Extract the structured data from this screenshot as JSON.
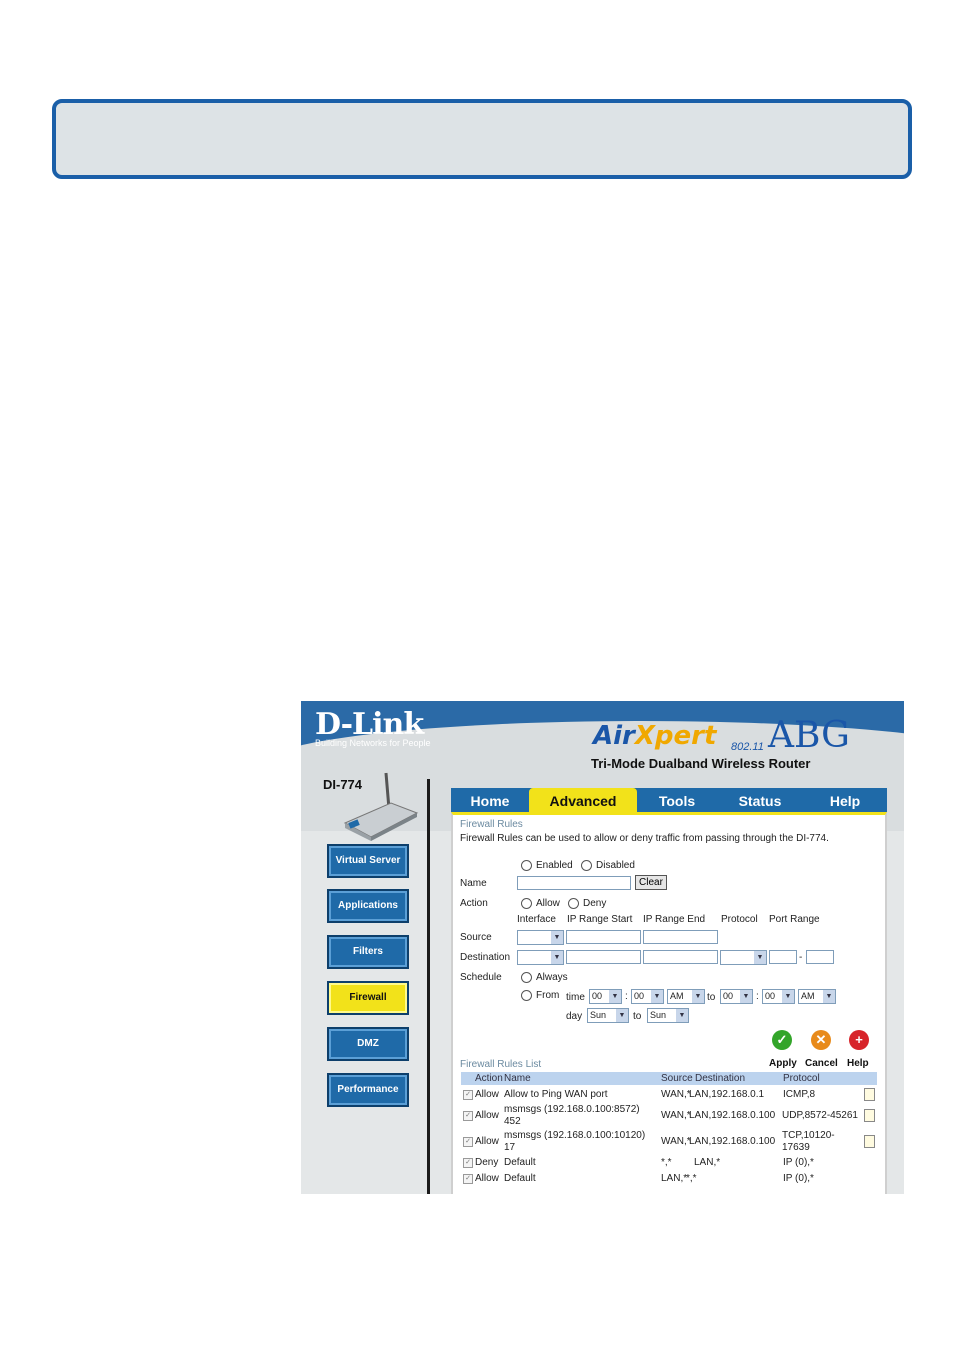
{
  "header": {
    "brand": "D-Link",
    "tagline": "Building Networks for People",
    "product_air": "Air",
    "product_x": "Xpert",
    "product_abg": "ABG",
    "product_80211": "802.11",
    "product_sub": "Tri-Mode Dualband Wireless Router",
    "model": "DI-774"
  },
  "sidebar": {
    "items": [
      {
        "label": "Virtual Server"
      },
      {
        "label": "Applications"
      },
      {
        "label": "Filters"
      },
      {
        "label": "Firewall"
      },
      {
        "label": "DMZ"
      },
      {
        "label": "Performance"
      }
    ]
  },
  "tabs": [
    "Home",
    "Advanced",
    "Tools",
    "Status",
    "Help"
  ],
  "firewall": {
    "title": "Firewall Rules",
    "description": "Firewall Rules can be used to allow or deny traffic from passing through the DI-774.",
    "enabled_label": "Enabled",
    "disabled_label": "Disabled",
    "name_label": "Name",
    "clear_label": "Clear",
    "action_label": "Action",
    "allow_label": "Allow",
    "deny_label": "Deny",
    "col_interface": "Interface",
    "col_ip_start": "IP Range Start",
    "col_ip_end": "IP Range End",
    "col_protocol": "Protocol",
    "col_port_range": "Port Range",
    "source_label": "Source",
    "destination_label": "Destination",
    "schedule_label": "Schedule",
    "always_label": "Always",
    "from_label": "From",
    "time_label": "time",
    "to_label": "to",
    "day_label": "day",
    "dash": "-",
    "colon": ":",
    "time_from_hour": "00",
    "time_from_min": "00",
    "time_from_ampm": "AM",
    "time_to_hour": "00",
    "time_to_min": "00",
    "time_to_ampm": "AM",
    "day_from": "Sun",
    "day_to": "Sun"
  },
  "actions": {
    "apply": "Apply",
    "cancel": "Cancel",
    "help": "Help"
  },
  "rules_list": {
    "title": "Firewall Rules List",
    "headers": [
      "Action",
      "Name",
      "Source",
      "Destination",
      "Protocol"
    ],
    "rows": [
      {
        "action": "Allow",
        "name": "Allow to Ping WAN port",
        "source": "WAN,*",
        "destination": "LAN,192.168.0.1",
        "protocol": "ICMP,8"
      },
      {
        "action": "Allow",
        "name": "msmsgs (192.168.0.100:8572)",
        "name2": "452",
        "source": "WAN,*",
        "destination": "LAN,192.168.0.100",
        "protocol": "UDP,8572-45261"
      },
      {
        "action": "Allow",
        "name": "msmsgs (192.168.0.100:10120)",
        "name2": "17",
        "source": "WAN,*",
        "destination": "LAN,192.168.0.100",
        "protocol": "TCP,10120-",
        "protocol2": "17639"
      },
      {
        "action": "Deny",
        "name": "Default",
        "source": "*,*",
        "destination": "LAN,*",
        "protocol": "IP (0),*"
      },
      {
        "action": "Allow",
        "name": "Default",
        "source": "LAN,*",
        "destination": "*,*",
        "protocol": "IP (0),*"
      }
    ]
  },
  "colors": {
    "frame_blue": "#1a5fa8",
    "nav_blue": "#1f6aa8",
    "active_yellow": "#f2e21a"
  }
}
